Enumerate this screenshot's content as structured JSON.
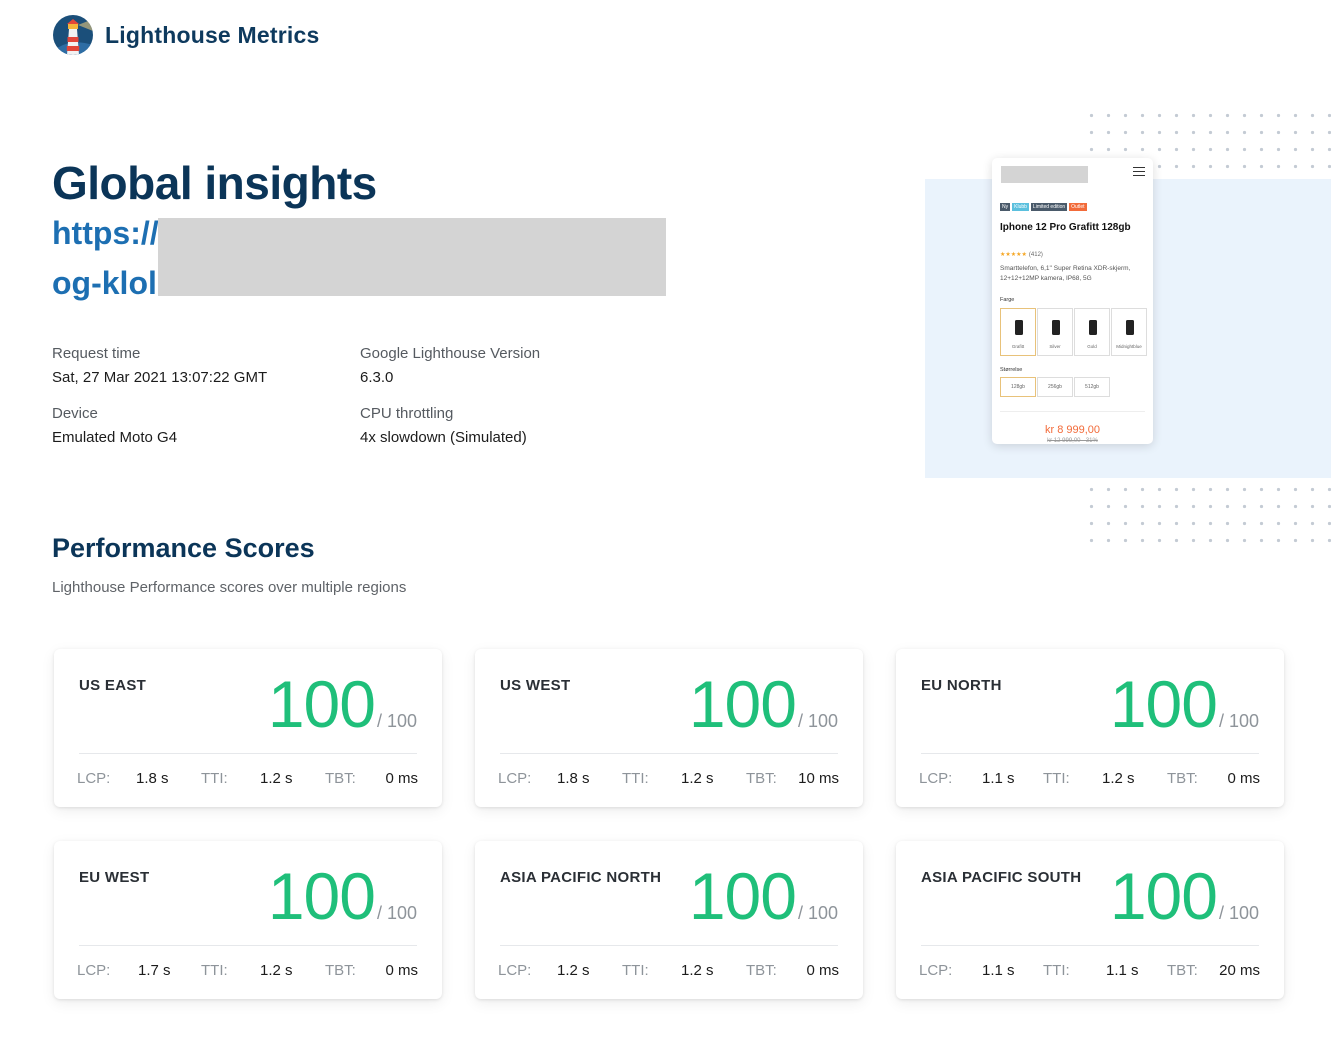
{
  "brand": {
    "name": "Lighthouse Metrics",
    "logo_icon": "lighthouse-icon"
  },
  "header": {
    "title": "Global insights",
    "url_line_1": "https://",
    "url_line_2": "og-klol"
  },
  "meta": {
    "request_time_label": "Request time",
    "request_time_value": "Sat, 27 Mar 2021 13:07:22 GMT",
    "version_label": "Google Lighthouse Version",
    "version_value": "6.3.0",
    "device_label": "Device",
    "device_value": "Emulated Moto G4",
    "cpu_label": "CPU throttling",
    "cpu_value": "4x slowdown (Simulated)"
  },
  "performance": {
    "title": "Performance Scores",
    "subtitle": "Lighthouse Performance scores over multiple regions",
    "lcp_label": "LCP:",
    "tti_label": "TTI:",
    "tbt_label": "TBT:",
    "max_label": "/ 100",
    "regions": [
      {
        "name": "US EAST",
        "score": "100",
        "lcp": "1.8 s",
        "tti": "1.2 s",
        "tbt": "0 ms"
      },
      {
        "name": "US WEST",
        "score": "100",
        "lcp": "1.8 s",
        "tti": "1.2 s",
        "tbt": "10 ms"
      },
      {
        "name": "EU NORTH",
        "score": "100",
        "lcp": "1.1 s",
        "tti": "1.2 s",
        "tbt": "0 ms"
      },
      {
        "name": "EU WEST",
        "score": "100",
        "lcp": "1.7 s",
        "tti": "1.2 s",
        "tbt": "0 ms"
      },
      {
        "name": "ASIA PACIFIC NORTH",
        "score": "100",
        "lcp": "1.2 s",
        "tti": "1.2 s",
        "tbt": "0 ms"
      },
      {
        "name": "ASIA PACIFIC SOUTH",
        "score": "100",
        "lcp": "1.1 s",
        "tti": "1.1 s",
        "tbt": "20 ms"
      }
    ]
  },
  "preview": {
    "tags": [
      "Ny",
      "Klubb",
      "Limited edition",
      "Outlet"
    ],
    "product_title": "Iphone 12 Pro Grafitt 128gb",
    "stars": "★★★★★",
    "review_count": "(412)",
    "description": "Smarttelefon, 6,1'' Super Retina XDR-skjerm, 12+12+12MP kamera, IP68, 5G",
    "color_label": "Farge",
    "colors": [
      "Grafitt",
      "Silver",
      "Gold",
      "Midnightblue"
    ],
    "size_label": "Størrelse",
    "sizes": [
      "128gb",
      "256gb",
      "512gb"
    ],
    "price": "kr 8 999,00",
    "old_price": "kr 12 999,00 · 31%"
  },
  "colors": {
    "title": "#0b3558",
    "link": "#1d6fb2",
    "score_green": "#1fbf7a",
    "price_orange": "#f26b3a"
  }
}
